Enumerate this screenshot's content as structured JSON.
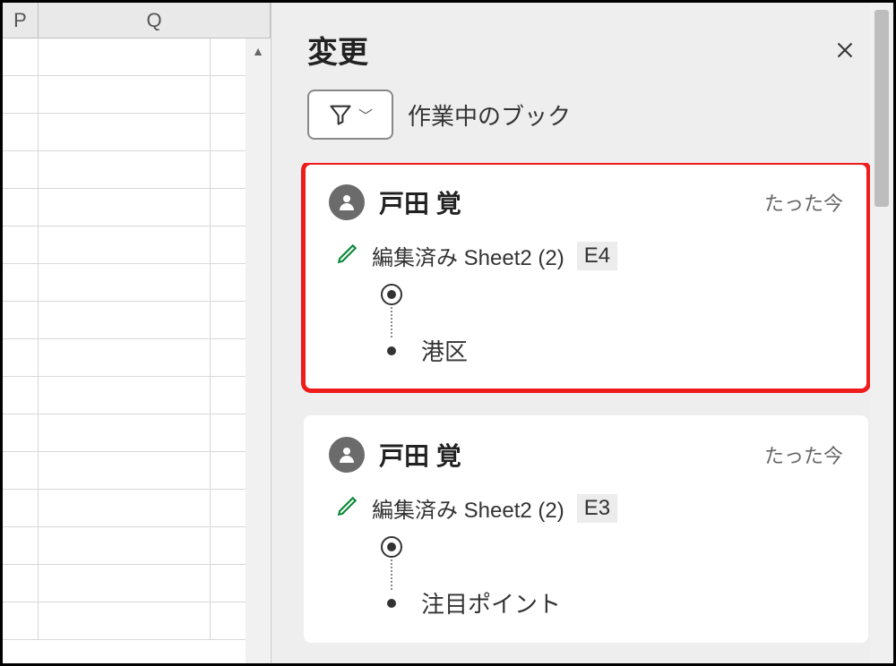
{
  "sheet": {
    "columns": {
      "p": "P",
      "q": "Q"
    }
  },
  "panel": {
    "title": "変更",
    "filter_scope": "作業中のブック"
  },
  "changes": [
    {
      "author": "戸田 覚",
      "time": "たった今",
      "action_prefix": "編集済み",
      "sheet_name": "Sheet2 (2)",
      "cell_ref": "E4",
      "new_value": "港区",
      "highlighted": true
    },
    {
      "author": "戸田 覚",
      "time": "たった今",
      "action_prefix": "編集済み",
      "sheet_name": "Sheet2 (2)",
      "cell_ref": "E3",
      "new_value": "注目ポイント",
      "highlighted": false
    }
  ]
}
